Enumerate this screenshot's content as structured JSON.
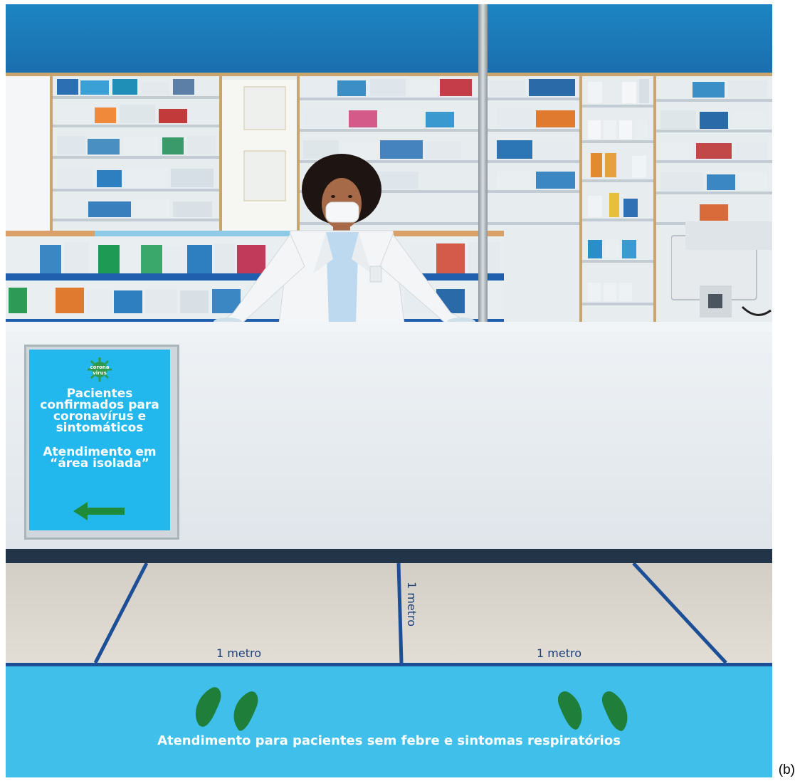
{
  "poster": {
    "logo_text": "corona\nvirus",
    "line1": "Pacientes",
    "line2": "confirmados para",
    "line3": "coronavírus e",
    "line4": "sintomáticos",
    "line5": "Atendimento em",
    "line6": "“área isolada”",
    "arrow": "left-arrow-icon"
  },
  "floor": {
    "label_left": "1 metro",
    "label_center": "1 metro",
    "label_right": "1 metro"
  },
  "strip": {
    "text": "Atendimento para pacientes sem febre e sintomas respiratórios"
  },
  "caption": "(b)",
  "colors": {
    "header_blue": "#1c85c2",
    "poster_blue": "#22b8ee",
    "arrow_green": "#1e8a3a",
    "floor_line_blue": "#1d4f96",
    "strip_blue": "#3fbfea",
    "footprint_green": "#1f7f3a"
  }
}
